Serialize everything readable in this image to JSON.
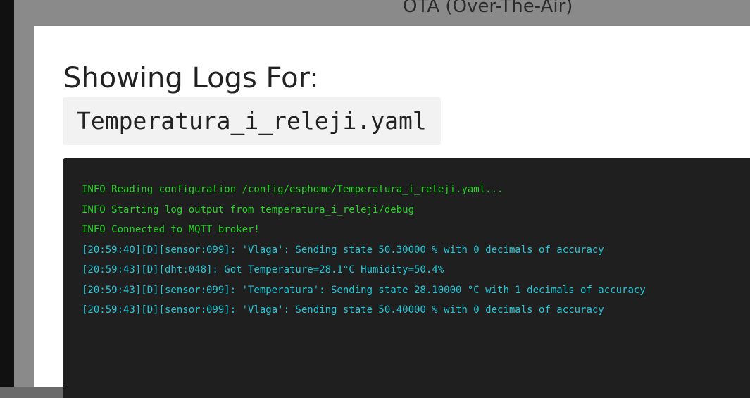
{
  "background": {
    "title": "OTA (Over-The-Air)"
  },
  "modal": {
    "title": "Showing Logs For:",
    "filename": "Temperatura_i_releji.yaml"
  },
  "logs": [
    {
      "level": "info",
      "text": "INFO Reading configuration /config/esphome/Temperatura_i_releji.yaml..."
    },
    {
      "level": "info",
      "text": "INFO Starting log output from temperatura_i_releji/debug"
    },
    {
      "level": "info",
      "text": "INFO Connected to MQTT broker!"
    },
    {
      "level": "debug",
      "text": "[20:59:40][D][sensor:099]: 'Vlaga': Sending state 50.30000 % with 0 decimals of accuracy"
    },
    {
      "level": "debug",
      "text": "[20:59:43][D][dht:048]: Got Temperature=28.1°C Humidity=50.4%"
    },
    {
      "level": "debug",
      "text": "[20:59:43][D][sensor:099]: 'Temperatura': Sending state 28.10000 °C with 1 decimals of accuracy"
    },
    {
      "level": "debug",
      "text": "[20:59:43][D][sensor:099]: 'Vlaga': Sending state 50.40000 % with 0 decimals of accuracy"
    }
  ],
  "colors": {
    "info": "#27d327",
    "debug": "#23c7d8",
    "log_background": "#1f1f1f"
  }
}
